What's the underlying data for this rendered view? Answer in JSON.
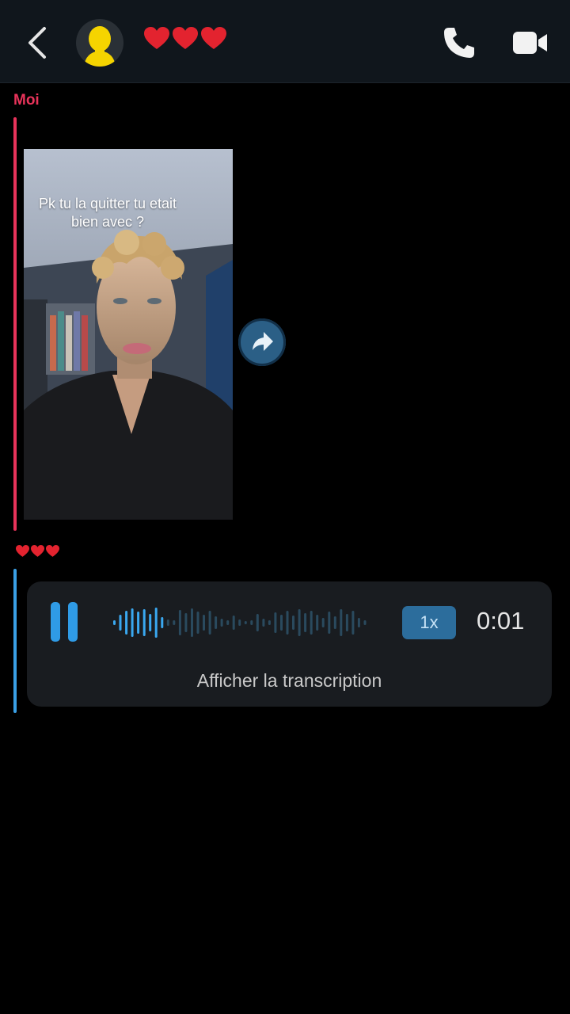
{
  "header": {
    "back_icon": "chevron-left-icon",
    "avatar_icon": "bitmoji-avatar-icon",
    "contact_name_hearts": "❤️❤️❤️",
    "call_icon": "phone-icon",
    "video_icon": "video-camera-icon"
  },
  "messages": {
    "sender_label": "Moi",
    "sender_color": "#e8335a",
    "snap": {
      "caption": "Pk tu la quitter tu etait bien avec ?",
      "share_icon": "share-arrow-icon"
    },
    "reaction": "❤️❤️❤️",
    "voice_note": {
      "accent_color": "#3aa0e6",
      "pause_icon": "pause-icon",
      "speed": "1x",
      "time": "0:01",
      "transcript_link": "Afficher la transcription",
      "progress": 0.2
    }
  }
}
